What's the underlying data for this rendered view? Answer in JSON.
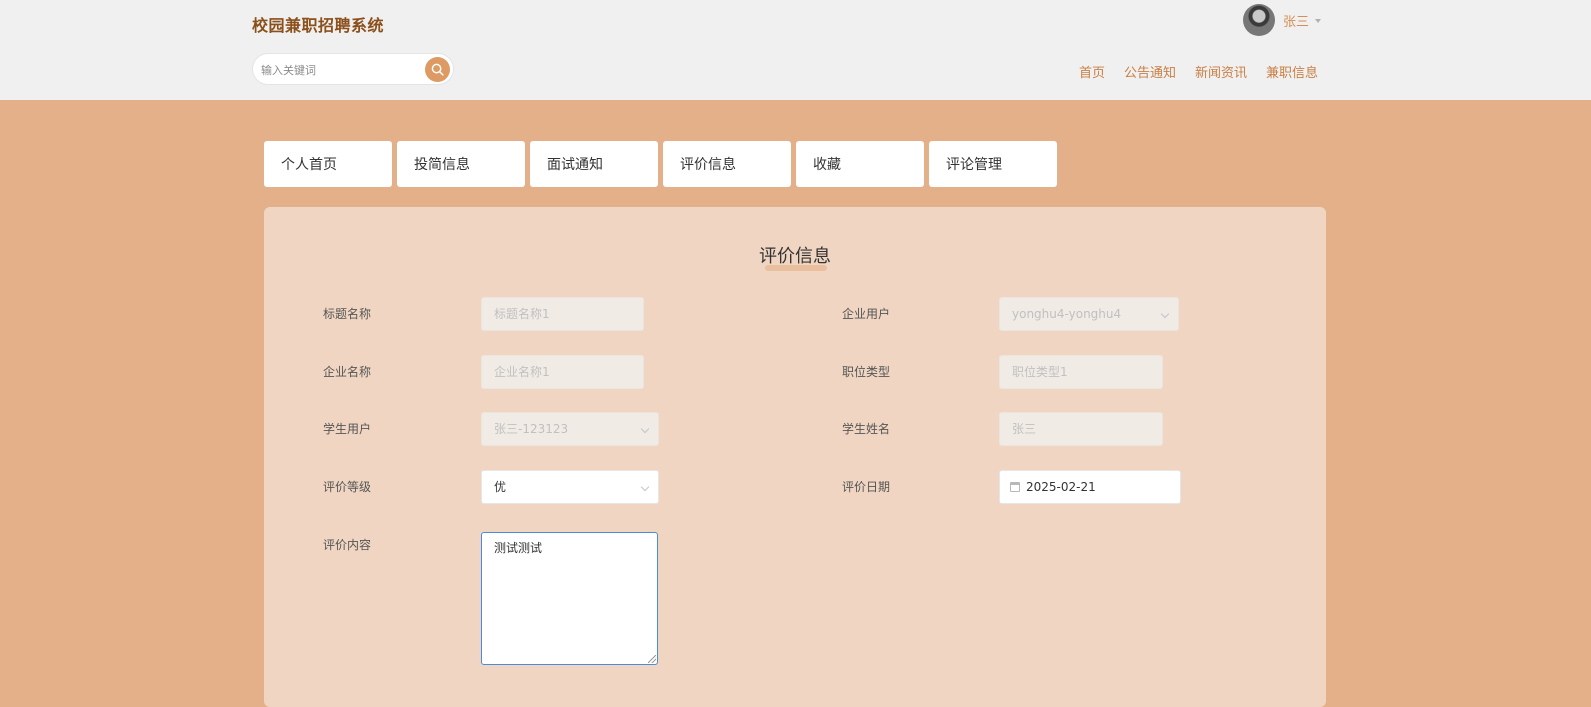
{
  "header": {
    "site_title": "校园兼职招聘系统",
    "search_placeholder": "输入关键词",
    "user_name": "张三",
    "nav": [
      "首页",
      "公告通知",
      "新闻资讯",
      "兼职信息"
    ]
  },
  "tabs": [
    "个人首页",
    "投简信息",
    "面试通知",
    "评价信息",
    "收藏",
    "评论管理"
  ],
  "form": {
    "title": "评价信息",
    "fields": {
      "title_name": {
        "label": "标题名称",
        "value": "标题名称1"
      },
      "company_user": {
        "label": "企业用户",
        "value": "yonghu4-yonghu4"
      },
      "company_name": {
        "label": "企业名称",
        "value": "企业名称1"
      },
      "job_type": {
        "label": "职位类型",
        "value": "职位类型1"
      },
      "student_user": {
        "label": "学生用户",
        "value": "张三-123123"
      },
      "student_name": {
        "label": "学生姓名",
        "value": "张三"
      },
      "rating": {
        "label": "评价等级",
        "value": "优"
      },
      "rating_date": {
        "label": "评价日期",
        "value": "2025-02-21"
      },
      "content": {
        "label": "评价内容",
        "value": "测试测试"
      }
    }
  },
  "colors": {
    "page_bg": "#e4b08a",
    "header_bg": "#f0f0f0",
    "card_bg": "#f0d6c2",
    "accent": "#dd9a62",
    "nav_text": "#c97f44",
    "site_title": "#8a4f1b"
  }
}
